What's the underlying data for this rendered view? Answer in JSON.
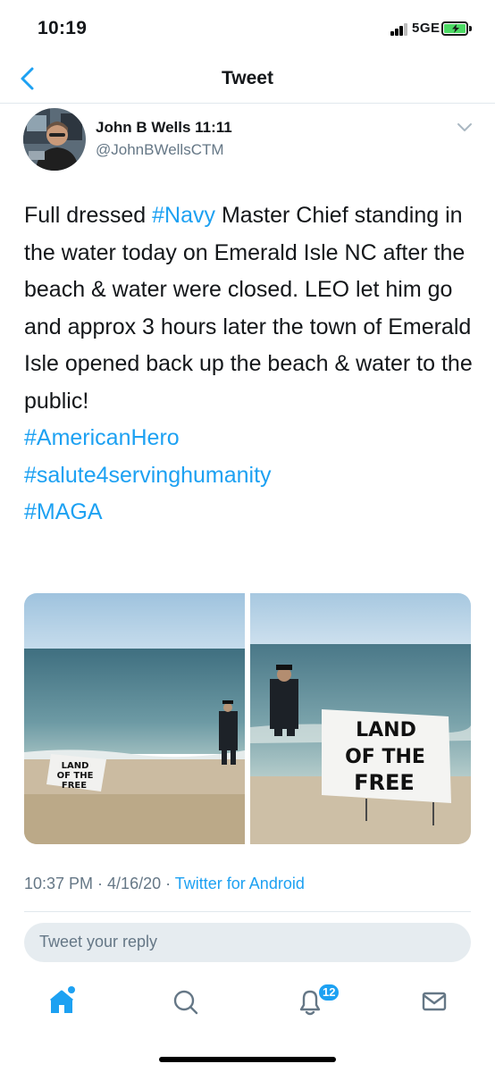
{
  "status_bar": {
    "time": "10:19",
    "network": "5GE"
  },
  "nav": {
    "title": "Tweet",
    "back_icon": "chevron-left-icon"
  },
  "tweet": {
    "author_name": "John B Wells 11:11",
    "handle": "@JohnBWellsCTM",
    "body": [
      {
        "text": "Full dressed "
      },
      {
        "text": "#Navy",
        "link": true
      },
      {
        "text": " Master Chief standing in the water today on Emerald Isle NC after the beach & water were closed. LEO let him go and approx 3 hours later the town of Emerald Isle opened back up the beach & water to the public!"
      }
    ],
    "hashtags": [
      "#AmericanHero",
      "#salute4servinghumanity",
      "#MAGA"
    ],
    "media": [
      {
        "sign_lines": [
          "LAND",
          "OF THE",
          "FREE"
        ]
      },
      {
        "sign_lines": [
          "LAND",
          "OF THE",
          "FREE"
        ]
      }
    ],
    "timestamp": "10:37 PM · 4/16/20 · ",
    "source": "Twitter for Android"
  },
  "reply": {
    "placeholder": "Tweet your reply"
  },
  "tab_bar": {
    "items": [
      {
        "icon": "home-icon",
        "active": true
      },
      {
        "icon": "search-icon",
        "active": false
      },
      {
        "icon": "notifications-icon",
        "active": false,
        "badge": "12"
      },
      {
        "icon": "messages-icon",
        "active": false
      }
    ]
  },
  "colors": {
    "accent": "#1da1f2",
    "text": "#14171a",
    "muted": "#657786",
    "battery": "#4cd964"
  }
}
